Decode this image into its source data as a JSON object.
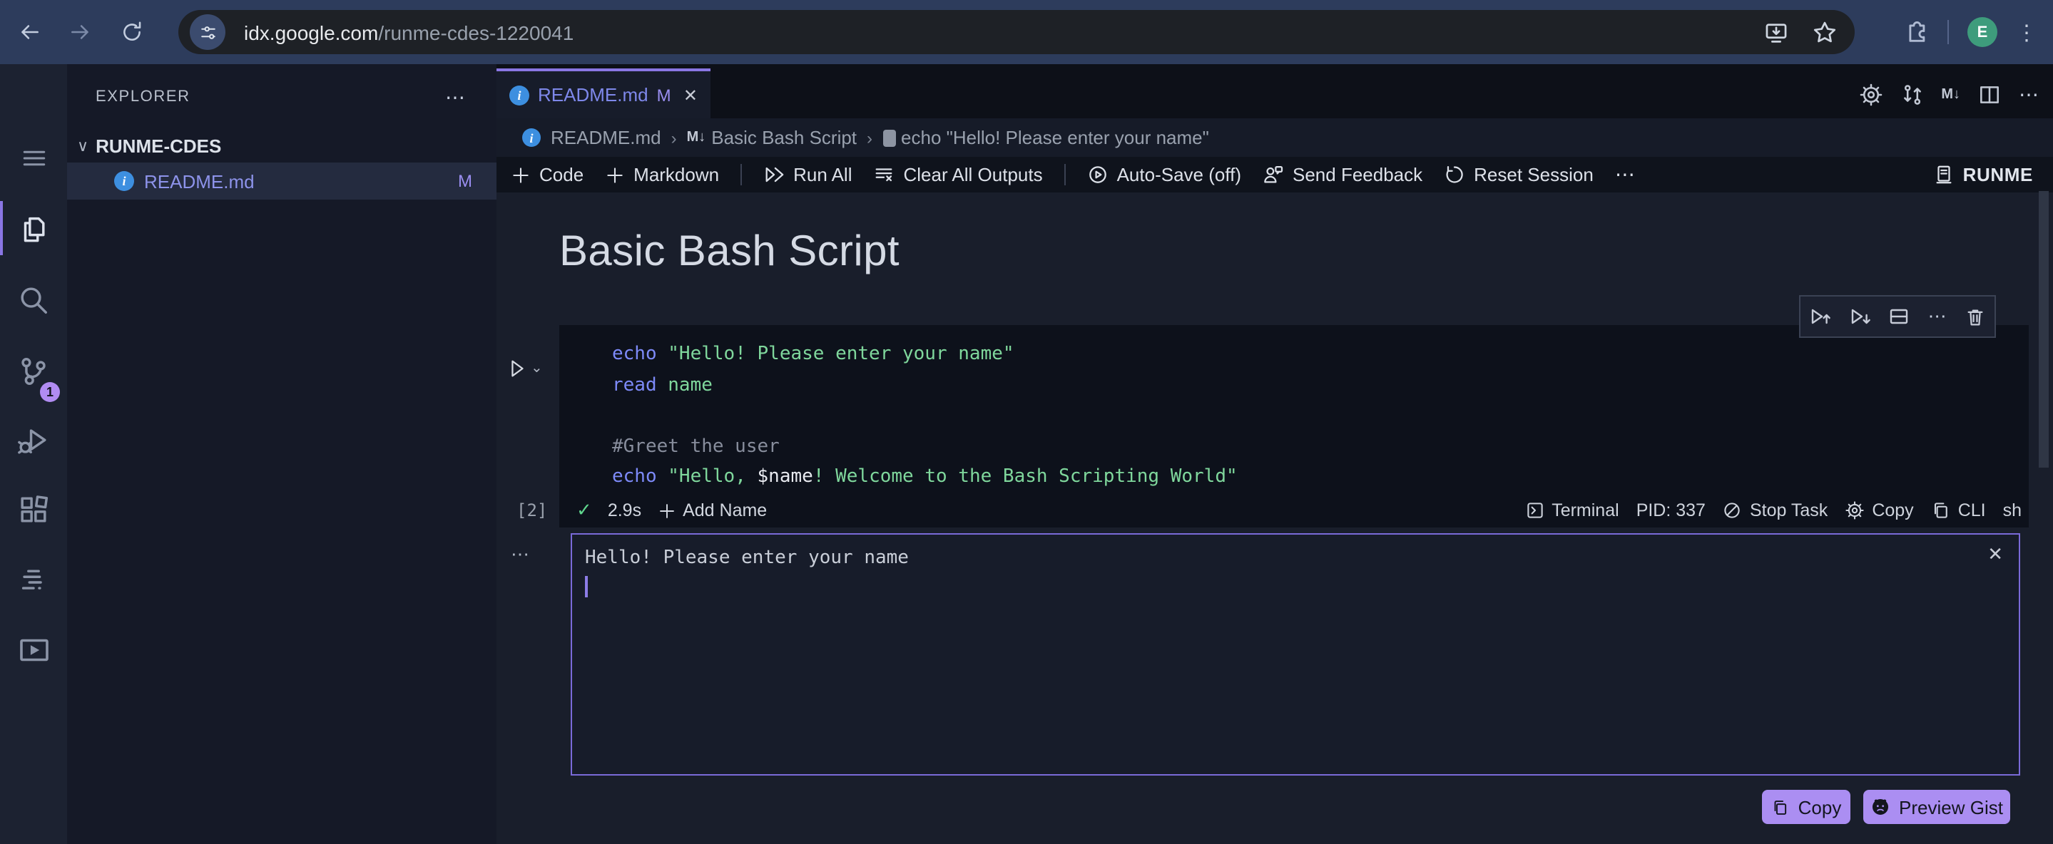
{
  "browser": {
    "url_host": "idx.google.com",
    "url_path": "/runme-cdes-1220041",
    "avatar_initial": "E"
  },
  "activity": {
    "scm_badge": "1"
  },
  "explorer": {
    "header": "EXPLORER",
    "workspace": "RUNME-CDES",
    "file": {
      "name": "README.md",
      "badge": "M"
    }
  },
  "tab": {
    "label": "README.md",
    "modified": "M"
  },
  "breadcrumbs": {
    "file": "README.md",
    "section": "Basic Bash Script",
    "cell": "echo \"Hello! Please enter your name\""
  },
  "toolbar": {
    "code": "Code",
    "markdown": "Markdown",
    "run_all": "Run All",
    "clear_all": "Clear All Outputs",
    "autosave": "Auto-Save (off)",
    "feedback": "Send Feedback",
    "reset": "Reset Session",
    "runme": "RUNME"
  },
  "notebook": {
    "title": "Basic Bash Script"
  },
  "cell": {
    "execution_count": "[2]",
    "duration": "2.9s",
    "add_name": "Add Name",
    "terminal": "Terminal",
    "pid": "PID: 337",
    "stop": "Stop Task",
    "configure": "Configure",
    "copy": "Copy",
    "cli": "CLI",
    "shell": "sh",
    "code": [
      [
        {
          "t": "kw",
          "v": "echo"
        },
        {
          "t": "pl",
          "v": " "
        },
        {
          "t": "str",
          "v": "\"Hello! Please enter your name\""
        }
      ],
      [
        {
          "t": "kw",
          "v": "read"
        },
        {
          "t": "pl",
          "v": " "
        },
        {
          "t": "str",
          "v": "name"
        }
      ],
      [],
      [
        {
          "t": "cmt",
          "v": "#Greet the user"
        }
      ],
      [
        {
          "t": "kw",
          "v": "echo"
        },
        {
          "t": "pl",
          "v": " "
        },
        {
          "t": "str",
          "v": "\"Hello, "
        },
        {
          "t": "var",
          "v": "$name"
        },
        {
          "t": "str",
          "v": "! Welcome to the Bash Scripting World\""
        }
      ]
    ]
  },
  "output": {
    "text": "Hello! Please enter your name"
  },
  "actions": {
    "copy": "Copy",
    "preview_gist": "Preview Gist"
  },
  "glyphs": {
    "ellipsis": "⋯",
    "kebab": "⋮",
    "check": "✓",
    "close": "✕",
    "chevron_down": "⌄",
    "tree_chevron": "∨",
    "separator": "›",
    "markdown_mark": "M↓",
    "plus": "+",
    "info": "i"
  },
  "colors": {
    "accent_purple": "#8a76e4",
    "button_purple": "#ab8ef2",
    "string_green": "#7fd79c",
    "keyword_blue": "#7d8af8",
    "info_blue": "#3d8fe0",
    "check_green": "#5fd58d",
    "chrome_navy": "#2d3c5c",
    "avatar_green": "#3e9c7c"
  }
}
